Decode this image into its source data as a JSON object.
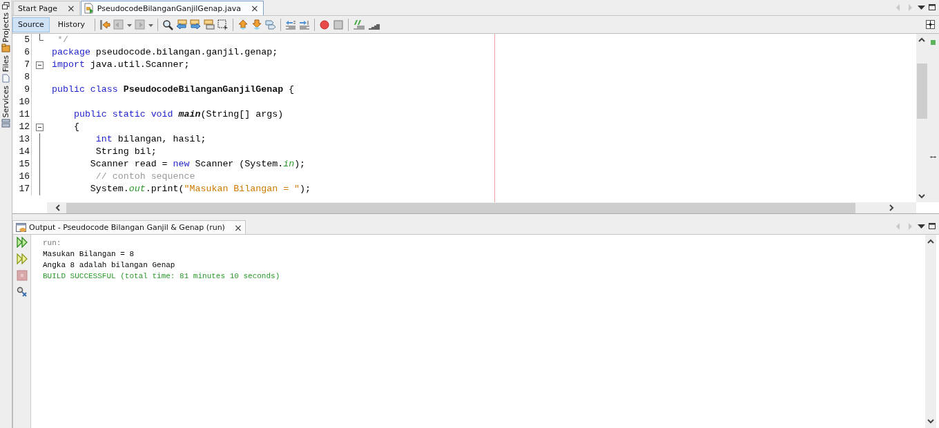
{
  "side_tabs": [
    {
      "label": "Projects"
    },
    {
      "label": "Files"
    },
    {
      "label": "Services"
    }
  ],
  "editor_tabs": [
    {
      "label": "Start Page",
      "selected": false,
      "close": "×"
    },
    {
      "label": "PseudocodeBilanganGanjilGenap.java",
      "selected": true,
      "close": "×"
    }
  ],
  "view_toggle": [
    {
      "label": "Source",
      "selected": true
    },
    {
      "label": "History",
      "selected": false
    }
  ],
  "code_lines": [
    {
      "number": "5",
      "fold_end": true,
      "tokens": [
        {
          "kind": "comment",
          "text": " */"
        }
      ]
    },
    {
      "number": "6",
      "tokens": [
        {
          "kind": "keyword",
          "text": "package"
        },
        {
          "kind": "plain",
          "text": " pseudocode.bilangan.ganjil.genap;"
        }
      ]
    },
    {
      "number": "7",
      "fold_toggle": true,
      "tokens": [
        {
          "kind": "keyword",
          "text": "import"
        },
        {
          "kind": "plain",
          "text": " java.util.Scanner;"
        }
      ]
    },
    {
      "number": "8"
    },
    {
      "number": "9",
      "tokens": [
        {
          "kind": "keyword",
          "text": "public class "
        },
        {
          "kind": "bold",
          "text": "PseudocodeBilanganGanjilGenap"
        },
        {
          "kind": "plain",
          "text": " {"
        }
      ]
    },
    {
      "number": "10"
    },
    {
      "number": "11",
      "tokens": [
        {
          "kind": "keyword",
          "text": "    public static void "
        },
        {
          "kind": "method",
          "text": "main"
        },
        {
          "kind": "plain",
          "text": "(String[] args)"
        }
      ]
    },
    {
      "number": "12",
      "fold_toggle": true,
      "tokens": [
        {
          "kind": "plain",
          "text": "    {"
        }
      ]
    },
    {
      "number": "13",
      "tokens": [
        {
          "kind": "keyword",
          "text": "        int"
        },
        {
          "kind": "plain",
          "text": " bilangan, hasil;"
        }
      ]
    },
    {
      "number": "14",
      "tokens": [
        {
          "kind": "plain",
          "text": "        String bil;"
        }
      ]
    },
    {
      "number": "15",
      "tokens": [
        {
          "kind": "plain",
          "text": "       Scanner read = "
        },
        {
          "kind": "keyword",
          "text": "new"
        },
        {
          "kind": "plain",
          "text": " Scanner (System."
        },
        {
          "kind": "field",
          "text": "in"
        },
        {
          "kind": "plain",
          "text": ");"
        }
      ]
    },
    {
      "number": "16",
      "tokens": [
        {
          "kind": "comment",
          "text": "        // contoh sequence"
        }
      ]
    },
    {
      "number": "17",
      "tokens": [
        {
          "kind": "plain",
          "text": "       System."
        },
        {
          "kind": "field",
          "text": "out"
        },
        {
          "kind": "plain",
          "text": ".print("
        },
        {
          "kind": "string",
          "text": "\"Masukan Bilangan = \""
        },
        {
          "kind": "plain",
          "text": ");"
        }
      ]
    }
  ],
  "output": {
    "title": "Output - Pseudocode Bilangan Ganjil & Genap (run)",
    "close": "×",
    "lines": [
      {
        "kind": "info",
        "text": "run:"
      },
      {
        "kind": "plain",
        "text": "Masukan Bilangan = 8"
      },
      {
        "kind": "plain",
        "text": "Angka 8 adalah bilangan Genap"
      },
      {
        "kind": "success",
        "text": "BUILD SUCCESSFUL (total time: 81 minutes 10 seconds)"
      }
    ]
  }
}
